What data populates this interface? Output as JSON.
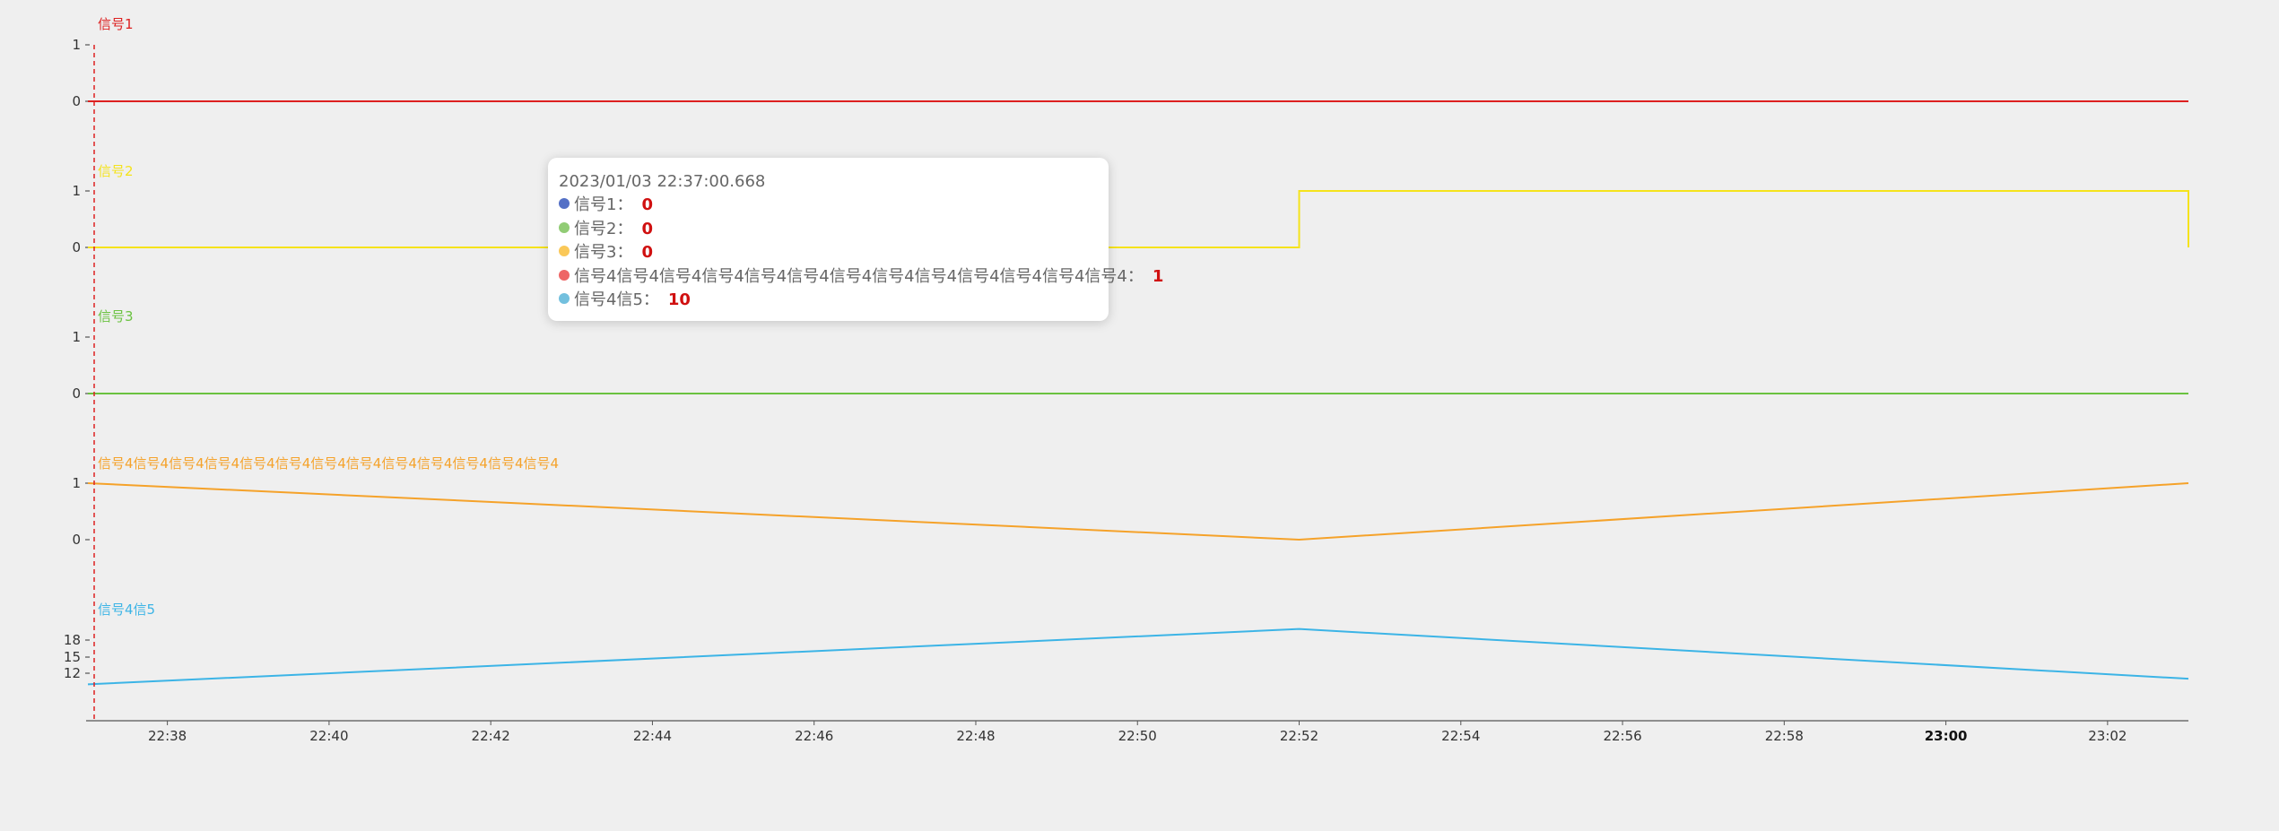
{
  "chart_data": {
    "type": "line",
    "x_axis": {
      "ticks": [
        "22:38",
        "22:40",
        "22:42",
        "22:44",
        "22:46",
        "22:48",
        "22:50",
        "22:52",
        "22:54",
        "22:56",
        "22:58",
        "23:00",
        "23:02"
      ],
      "bold_tick": "23:00",
      "range": [
        "22:37:05",
        "23:03:00"
      ]
    },
    "cursor_x": "22:37:00.668",
    "series": [
      {
        "name": "信号1",
        "color": "#dd2020",
        "step": true,
        "y_ticks": [
          1,
          0
        ],
        "y_range": [
          0,
          1
        ],
        "points": [
          [
            "22:37:00",
            0
          ],
          [
            "23:03:00",
            0
          ]
        ]
      },
      {
        "name": "信号2",
        "color": "#f5e31b",
        "step": true,
        "y_ticks": [
          1,
          0
        ],
        "y_range": [
          0,
          1
        ],
        "points": [
          [
            "22:37:00",
            0
          ],
          [
            "22:52:00",
            1
          ],
          [
            "23:03:00",
            1
          ],
          [
            "23:03:00",
            0
          ]
        ]
      },
      {
        "name": "信号3",
        "color": "#6ac240",
        "step": true,
        "y_ticks": [
          1,
          0
        ],
        "y_range": [
          0,
          1
        ],
        "points": [
          [
            "22:37:00",
            0
          ],
          [
            "23:03:00",
            0
          ]
        ]
      },
      {
        "name": "信号4信号4信号4信号4信号4信号4信号4信号4信号4信号4信号4信号4信号4",
        "color": "#f5a22a",
        "step": false,
        "y_ticks": [
          1,
          0
        ],
        "y_range": [
          0,
          1
        ],
        "points": [
          [
            "22:37:00",
            1
          ],
          [
            "22:52:00",
            0
          ],
          [
            "23:03:00",
            1
          ]
        ]
      },
      {
        "name": "信号4信5",
        "color": "#3cb4e6",
        "step": false,
        "y_ticks": [
          18,
          15,
          12
        ],
        "y_range": [
          12,
          18
        ],
        "points": [
          [
            "22:37:00",
            10
          ],
          [
            "22:52:00",
            20
          ],
          [
            "23:03:00",
            11
          ]
        ]
      }
    ]
  },
  "tooltip": {
    "time": "2023/01/03 22:37:00.668",
    "rows": [
      {
        "label": "信号1：",
        "value": "0",
        "dot_color": "#5470c6"
      },
      {
        "label": "信号2：",
        "value": "0",
        "dot_color": "#91cc75"
      },
      {
        "label": "信号3：",
        "value": "0",
        "dot_color": "#fac858"
      },
      {
        "label": "信号4信号4信号4信号4信号4信号4信号4信号4信号4信号4信号4信号4信号4：",
        "value": "1",
        "dot_color": "#ee6666"
      },
      {
        "label": "信号4信5：",
        "value": "10",
        "dot_color": "#73c0de"
      }
    ]
  }
}
